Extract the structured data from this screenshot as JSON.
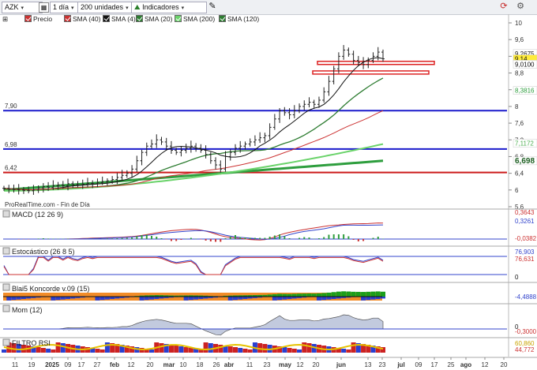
{
  "toolbar": {
    "symbol": "AZK",
    "timeframe": "1 día",
    "units": "200 unidades",
    "indicators_label": "Indicadores"
  },
  "legend": [
    {
      "label": "Precio",
      "color": "#cc3333"
    },
    {
      "label": "SMA (40)",
      "color": "#cc3333"
    },
    {
      "label": "SMA (4)",
      "color": "#111111"
    },
    {
      "label": "SMA (20)",
      "color": "#2e7d32"
    },
    {
      "label": "SMA (200)",
      "color": "#6ad36a"
    },
    {
      "label": "SMA (120)",
      "color": "#2e7d32"
    }
  ],
  "main_panel": {
    "watermark": "ProRealTime.com - Fin de Día",
    "y_ticks": [
      "10",
      "9,6",
      "9,2",
      "8,8",
      "8,4",
      "8",
      "7,6",
      "7,2",
      "6,8",
      "6,4",
      "6",
      "5,6"
    ],
    "price_labels": [
      {
        "text": "9,2675",
        "value": 9.2675,
        "color": "#ffffff",
        "text_color": "#111111"
      },
      {
        "text": "9,14",
        "value": 9.14,
        "color": "#ffeb3b",
        "text_color": "#111111"
      },
      {
        "text": "9,0100",
        "value": 9.01,
        "color": "#ffffff",
        "text_color": "#111111"
      },
      {
        "text": "8,3816",
        "value": 8.3816,
        "color": "#ffffff",
        "text_color": "#2e9e3e"
      },
      {
        "text": "7,1172",
        "value": 7.1172,
        "color": "#ffffff",
        "text_color": "#4caf50"
      },
      {
        "text": "6,698",
        "value": 6.698,
        "color": "#ffffff",
        "text_color": "#1b5e20"
      }
    ],
    "hlines": [
      {
        "text": "7,90",
        "value": 7.9,
        "color": "#1a1acc"
      },
      {
        "text": "6,98",
        "value": 6.98,
        "color": "#1a1acc"
      },
      {
        "text": "6,42",
        "value": 6.42,
        "color": "#cc1a1a"
      }
    ],
    "rectangles": [
      {
        "from": 9.08,
        "to": 9.05
      },
      {
        "from": 8.85,
        "to": 8.82
      }
    ]
  },
  "panels": [
    {
      "title": "MACD (12 26 9)",
      "labels": [
        {
          "text": "0,3643",
          "color": "#cc3333"
        },
        {
          "text": "0,3261",
          "color": "#3344cc"
        },
        {
          "text": "-0,0382",
          "color": "#cc3333"
        }
      ]
    },
    {
      "title": "Estocástico (26 8 5)",
      "labels": [
        {
          "text": "76,903",
          "color": "#3344cc"
        },
        {
          "text": "76,631",
          "color": "#cc3333"
        },
        {
          "text": "0",
          "color": "#111111"
        }
      ]
    },
    {
      "title": "Blai5 Koncorde v.09 (15)",
      "labels": [
        {
          "text": "-4,4888",
          "color": "#3344cc"
        }
      ]
    },
    {
      "title": "Mom (12)",
      "labels": [
        {
          "text": "0",
          "color": "#111111"
        },
        {
          "text": "-0,3000",
          "color": "#cc3333"
        }
      ]
    },
    {
      "title": "FILTRO RSI",
      "labels": [
        {
          "text": "60,860",
          "color": "#c9a400"
        },
        {
          "text": "44,772",
          "color": "#cc3333"
        }
      ]
    }
  ],
  "x_axis": [
    "11",
    "19",
    "2025",
    "09",
    "17",
    "27",
    "feb",
    "12",
    "20",
    "mar",
    "10",
    "18",
    "26",
    "abr",
    "11",
    "23",
    "may",
    "12",
    "20",
    "jun",
    "13",
    "23",
    "jul",
    "09",
    "17",
    "25",
    "ago",
    "12",
    "20"
  ],
  "chart_data": {
    "type": "line",
    "title": "AZK",
    "y_range": [
      5.5,
      10.1
    ],
    "close": [
      6.04,
      6.02,
      6.01,
      6.0,
      5.99,
      5.98,
      6.0,
      6.05,
      6.08,
      6.06,
      6.1,
      6.12,
      6.1,
      6.15,
      6.13,
      6.12,
      6.14,
      6.16,
      6.15,
      6.18,
      6.2,
      6.22,
      6.25,
      6.3,
      6.35,
      6.4,
      6.5,
      6.7,
      6.9,
      7.05,
      7.1,
      7.2,
      7.15,
      7.05,
      6.95,
      6.9,
      6.95,
      7.0,
      7.05,
      7.0,
      6.95,
      6.85,
      6.7,
      6.6,
      6.5,
      6.8,
      6.9,
      7.0,
      7.05,
      7.1,
      7.15,
      7.2,
      7.25,
      7.3,
      7.5,
      7.7,
      7.9,
      7.85,
      7.8,
      7.9,
      8.0,
      8.05,
      8.1,
      8.05,
      8.15,
      8.35,
      8.6,
      8.9,
      9.2,
      9.35,
      9.25,
      9.1,
      9.05,
      9.0,
      9.1,
      9.2,
      9.3,
      9.14
    ]
  }
}
